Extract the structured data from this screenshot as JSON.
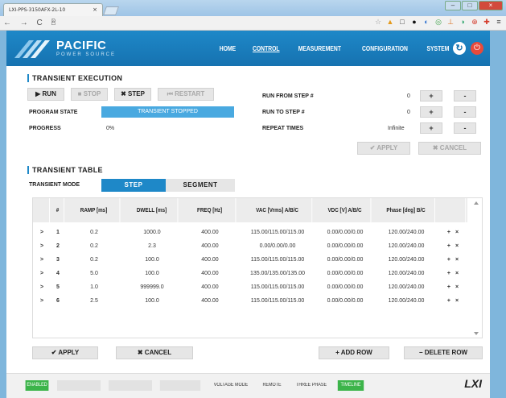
{
  "browser": {
    "tab_title": "LXI-PPS-3150AFX-2L-10",
    "tab_close": "×",
    "address": "D",
    "nav_glyphs": "← → C ⌂",
    "ext_icons": [
      "☆",
      "▲",
      "□",
      "●",
      "◐",
      "◎",
      "⊥",
      "◑",
      "⊕",
      "✚",
      "≡"
    ]
  },
  "app": {
    "logo": "PACIFIC",
    "logo_sub": "POWER SOURCE",
    "menu": [
      "HOME",
      "CONTROL",
      "MEASUREMENT",
      "CONFIGURATION",
      "SYSTEM"
    ],
    "active_menu": "CONTROL",
    "refresh_glyph": "↻",
    "power_glyph": "⏻"
  },
  "execution": {
    "title": "TRANSIENT EXECUTION",
    "run": "▶ RUN",
    "stop": "■ STOP",
    "step": "✖ STEP",
    "restart": "⏮ RESTART",
    "program_state_label": "PROGRAM STATE",
    "program_state_value": "TRANSIENT STOPPED",
    "progress_label": "PROGRESS",
    "progress_value": "0%",
    "run_from_label": "RUN FROM STEP #",
    "run_from_value": "0",
    "run_to_label": "RUN TO STEP #",
    "run_to_value": "0",
    "repeat_label": "REPEAT TIMES",
    "repeat_value": "Infinite",
    "plus": "+",
    "minus": "-",
    "apply": "✔ APPLY",
    "cancel": "✖ CANCEL"
  },
  "table_section": {
    "title": "TRANSIENT TABLE",
    "mode_label": "TRANSIENT MODE",
    "mode_step": "STEP",
    "mode_segment": "SEGMENT",
    "headers": [
      "#",
      "RAMP [ms]",
      "DWELL [ms]",
      "FREQ [Hz]",
      "VAC [Vrms] A/B/C",
      "VDC [V] A/B/C",
      "Phase [deg] B/C"
    ],
    "rows": [
      {
        "n": "1",
        "ramp": "0.2",
        "dwell": "1000.0",
        "freq": "400.00",
        "vac": "115.00/115.00/115.00",
        "vdc": "0.00/0.00/0.00",
        "phase": "120.00/240.00"
      },
      {
        "n": "2",
        "ramp": "0.2",
        "dwell": "2.3",
        "freq": "400.00",
        "vac": "0.00/0.00/0.00",
        "vdc": "0.00/0.00/0.00",
        "phase": "120.00/240.00"
      },
      {
        "n": "3",
        "ramp": "0.2",
        "dwell": "100.0",
        "freq": "400.00",
        "vac": "115.00/115.00/115.00",
        "vdc": "0.00/0.00/0.00",
        "phase": "120.00/240.00"
      },
      {
        "n": "4",
        "ramp": "5.0",
        "dwell": "100.0",
        "freq": "400.00",
        "vac": "135.00/135.00/135.00",
        "vdc": "0.00/0.00/0.00",
        "phase": "120.00/240.00"
      },
      {
        "n": "5",
        "ramp": "1.0",
        "dwell": "999999.0",
        "freq": "400.00",
        "vac": "115.00/115.00/115.00",
        "vdc": "0.00/0.00/0.00",
        "phase": "120.00/240.00"
      },
      {
        "n": "6",
        "ramp": "2.5",
        "dwell": "100.0",
        "freq": "400.00",
        "vac": "115.00/115.00/115.00",
        "vdc": "0.00/0.00/0.00",
        "phase": "120.00/240.00"
      }
    ],
    "row_expand": ">",
    "row_add": "+",
    "row_delete": "×",
    "apply": "✔ APPLY",
    "cancel": "✖ CANCEL",
    "add_row": "+ ADD ROW",
    "delete_row": "− DELETE ROW"
  },
  "footer": {
    "enabled": "ENABLED",
    "voltage_mode": "VOLTAGE MODE",
    "remote": "REMOTE",
    "three_phase": "THREE PHASE",
    "timeline": "TIMELINE",
    "lxi": "LXI"
  },
  "colors": {
    "accent": "#1e88c8",
    "green": "#3cb44a",
    "state_blue": "#49a9e0"
  }
}
